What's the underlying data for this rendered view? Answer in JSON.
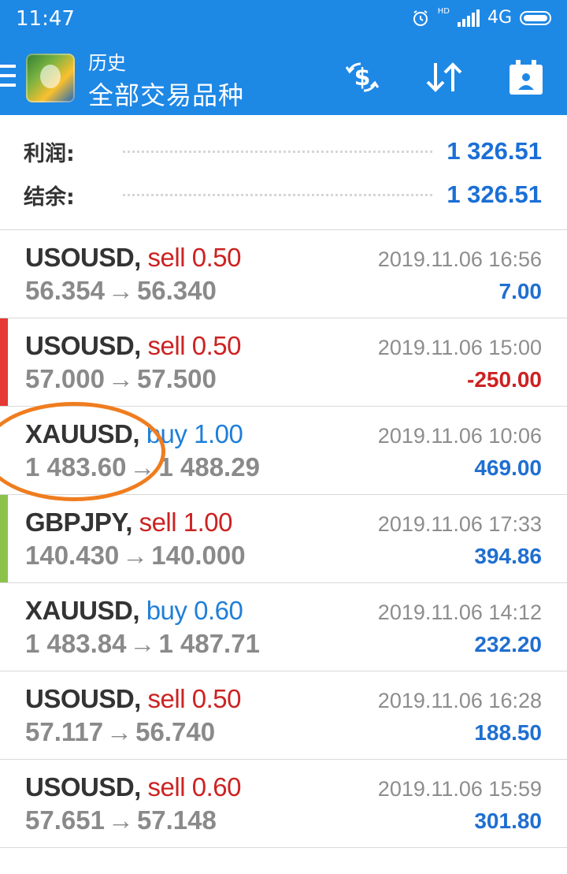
{
  "status_bar": {
    "time": "11:47",
    "network": "4G",
    "network_sup": "HD"
  },
  "app_bar": {
    "subtitle": "历史",
    "title": "全部交易品种",
    "icons": [
      "menu-icon",
      "metatrader-logo",
      "exchange-dollar-icon",
      "sort-icon",
      "calendar-icon"
    ]
  },
  "summary": {
    "profit_label": "利润:",
    "profit_value": "1 326.51",
    "balance_label": "结余:",
    "balance_value": "1 326.51"
  },
  "colors": {
    "accent": "#1e88e5",
    "sell": "#cc2222",
    "buy": "#1f7fd8",
    "highlight": "#ef7d1f"
  },
  "trades": [
    {
      "symbol": "USOUSD,",
      "type": "sell",
      "volume": "0.50",
      "open": "56.354",
      "close": "56.340",
      "time": "2019.11.06 16:56",
      "profit": "7.00",
      "marker": ""
    },
    {
      "symbol": "USOUSD,",
      "type": "sell",
      "volume": "0.50",
      "open": "57.000",
      "close": "57.500",
      "time": "2019.11.06 15:00",
      "profit": "-250.00",
      "marker": "#e53935"
    },
    {
      "symbol": "XAUUSD,",
      "type": "buy",
      "volume": "1.00",
      "open": "1 483.60",
      "close": "1 488.29",
      "time": "2019.11.06 10:06",
      "profit": "469.00",
      "marker": ""
    },
    {
      "symbol": "GBPJPY,",
      "type": "sell",
      "volume": "1.00",
      "open": "140.430",
      "close": "140.000",
      "time": "2019.11.06 17:33",
      "profit": "394.86",
      "marker": "#8bc34a"
    },
    {
      "symbol": "XAUUSD,",
      "type": "buy",
      "volume": "0.60",
      "open": "1 483.84",
      "close": "1 487.71",
      "time": "2019.11.06 14:12",
      "profit": "232.20",
      "marker": ""
    },
    {
      "symbol": "USOUSD,",
      "type": "sell",
      "volume": "0.50",
      "open": "57.117",
      "close": "56.740",
      "time": "2019.11.06 16:28",
      "profit": "188.50",
      "marker": ""
    },
    {
      "symbol": "USOUSD,",
      "type": "sell",
      "volume": "0.60",
      "open": "57.651",
      "close": "57.148",
      "time": "2019.11.06 15:59",
      "profit": "301.80",
      "marker": ""
    }
  ],
  "arrow_glyph": "→"
}
